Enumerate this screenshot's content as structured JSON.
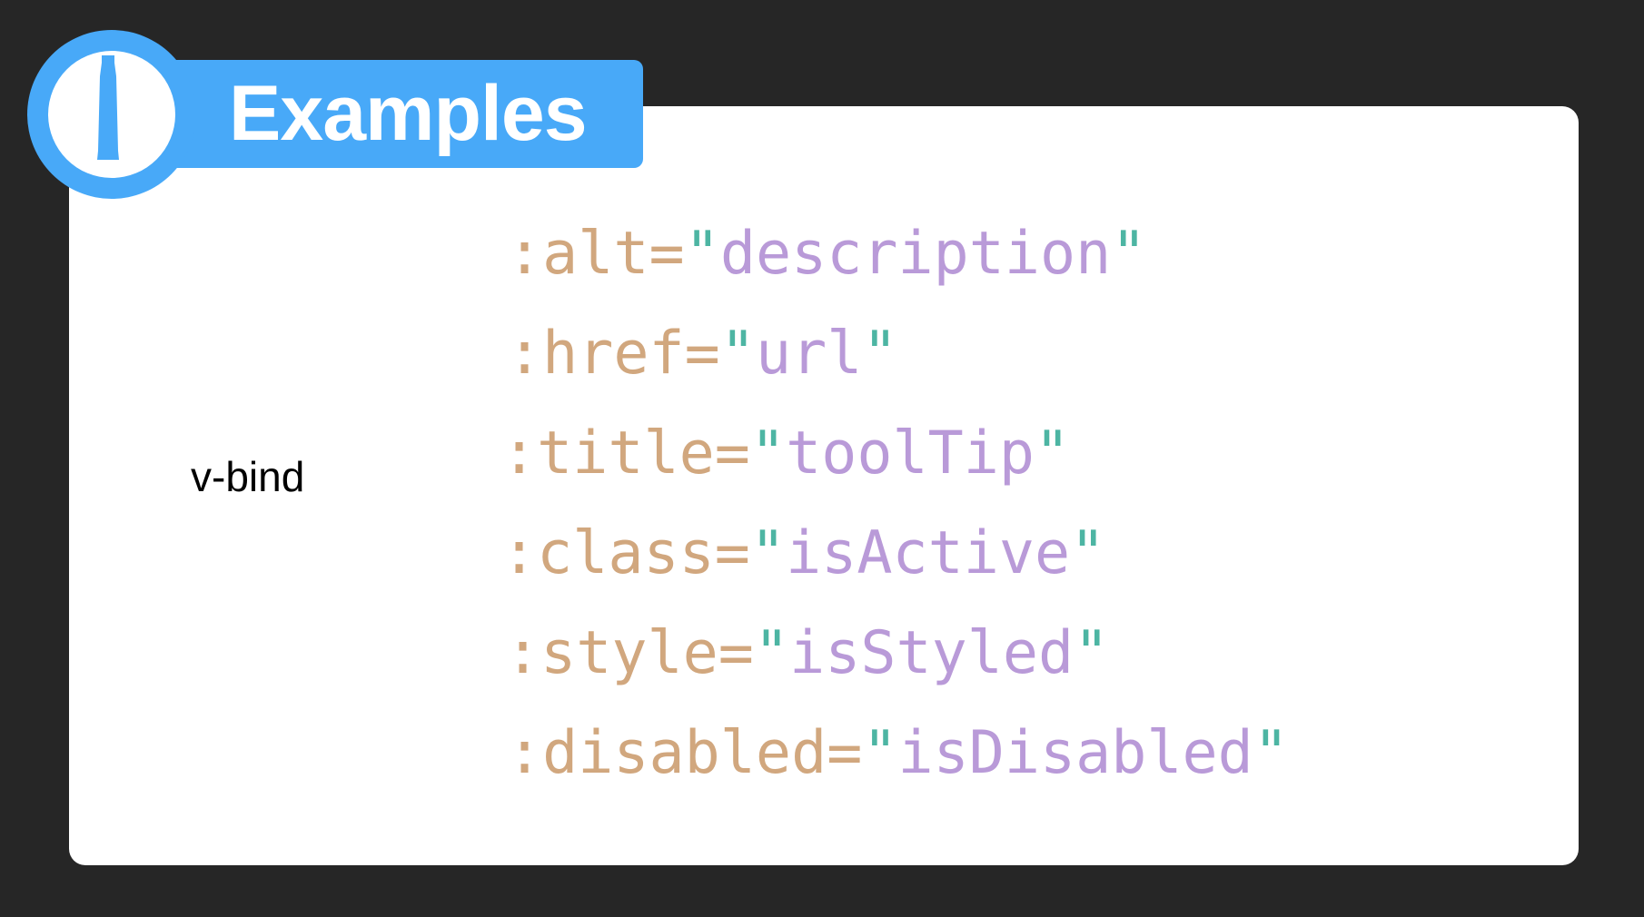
{
  "header": {
    "title": "Examples",
    "icon": "tube-icon"
  },
  "colors": {
    "background": "#262626",
    "card": "#ffffff",
    "accent": "#48a9f8",
    "attribute": "#d1a77e",
    "quote": "#4db5a3",
    "value": "#b99ad8"
  },
  "directive": {
    "label": "v-bind"
  },
  "bindings": [
    {
      "attr": ":alt=",
      "value": "description"
    },
    {
      "attr": ":href=",
      "value": "url"
    },
    {
      "attr": ":title=",
      "value": "toolTip"
    },
    {
      "attr": ":class=",
      "value": "isActive"
    },
    {
      "attr": ":style=",
      "value": "isStyled"
    },
    {
      "attr": ":disabled=",
      "value": "isDisabled"
    }
  ],
  "quote_char": "\""
}
